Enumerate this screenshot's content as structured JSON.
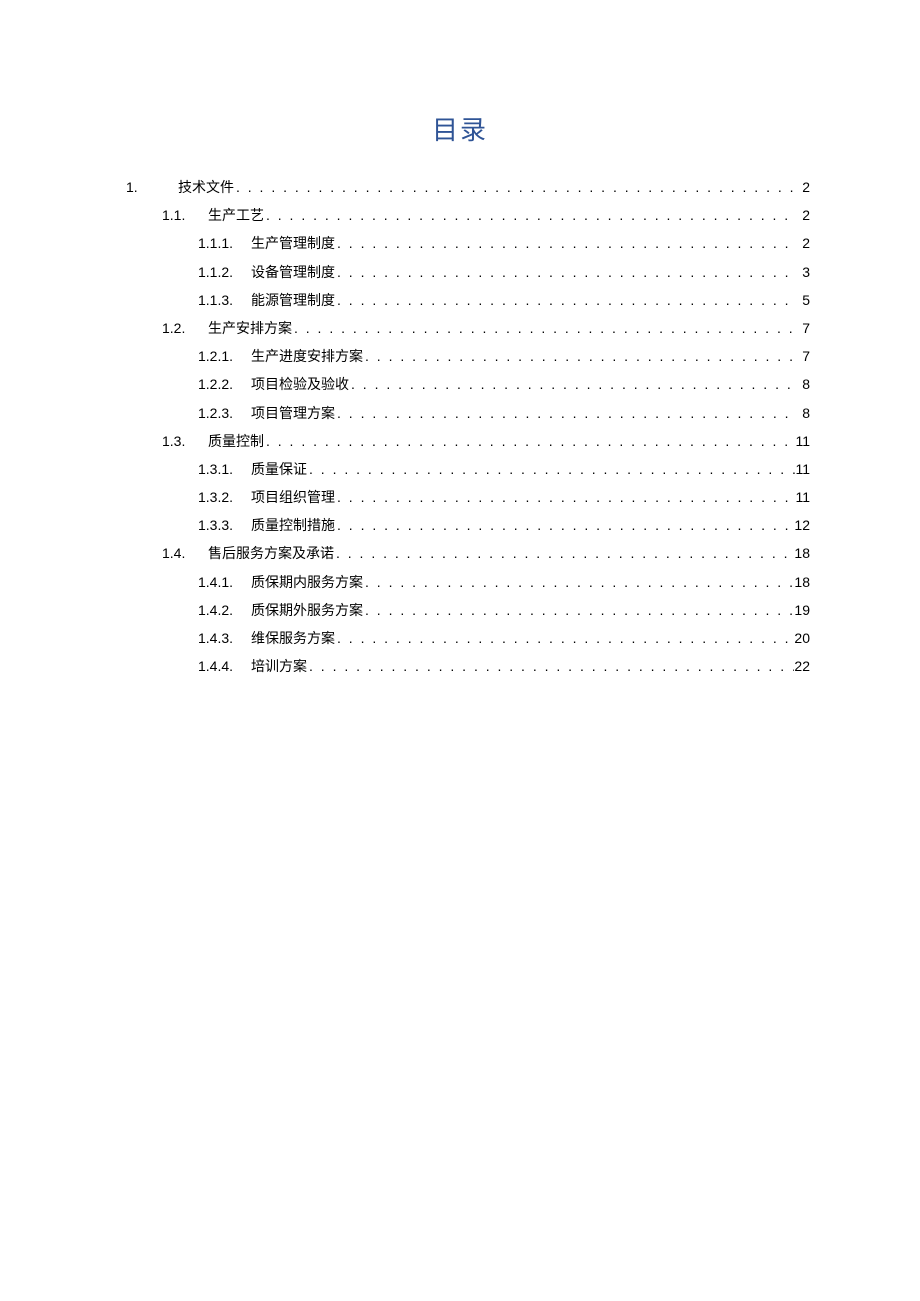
{
  "title": "目录",
  "entries": [
    {
      "level": 0,
      "num": "1.",
      "label": "技术文件",
      "page": "2"
    },
    {
      "level": 1,
      "num": "1.1.",
      "label": "生产工艺",
      "page": "2"
    },
    {
      "level": 2,
      "num": "1.1.1.",
      "label": "生产管理制度",
      "page": "2"
    },
    {
      "level": 2,
      "num": "1.1.2.",
      "label": "设备管理制度",
      "page": "3"
    },
    {
      "level": 2,
      "num": "1.1.3.",
      "label": "能源管理制度",
      "page": "5"
    },
    {
      "level": 1,
      "num": "1.2.",
      "label": "生产安排方案",
      "page": "7"
    },
    {
      "level": 2,
      "num": "1.2.1.",
      "label": "生产进度安排方案",
      "page": "7"
    },
    {
      "level": 2,
      "num": "1.2.2.",
      "label": "项目检验及验收",
      "page": "8"
    },
    {
      "level": 2,
      "num": "1.2.3.",
      "label": "项目管理方案",
      "page": "8"
    },
    {
      "level": 1,
      "num": "1.3.",
      "label": "质量控制",
      "page": "11"
    },
    {
      "level": 2,
      "num": "1.3.1.",
      "label": "质量保证",
      "page": "11"
    },
    {
      "level": 2,
      "num": "1.3.2.",
      "label": "项目组织管理",
      "page": "11"
    },
    {
      "level": 2,
      "num": "1.3.3.",
      "label": "质量控制措施",
      "page": "12"
    },
    {
      "level": 1,
      "num": "1.4.",
      "label": "售后服务方案及承诺",
      "page": "18"
    },
    {
      "level": 2,
      "num": "1.4.1.",
      "label": "质保期内服务方案",
      "page": "18"
    },
    {
      "level": 2,
      "num": "1.4.2.",
      "label": "质保期外服务方案",
      "page": "19"
    },
    {
      "level": 2,
      "num": "1.4.3.",
      "label": "维保服务方案",
      "page": "20"
    },
    {
      "level": 2,
      "num": "1.4.4.",
      "label": "培训方案",
      "page": "22"
    }
  ]
}
